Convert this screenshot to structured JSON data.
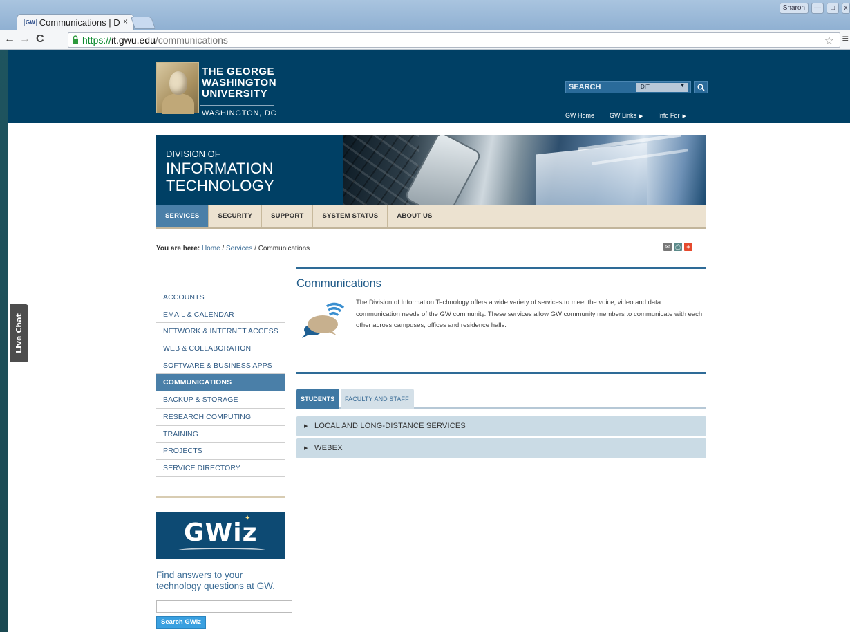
{
  "browser": {
    "tab_title": "Communications | D",
    "tab_favicon": "GW",
    "tab_close": "×",
    "user_label": "Sharon",
    "url_scheme": "https://",
    "url_host": "it.gwu.edu",
    "url_path": "/communications"
  },
  "header": {
    "logo_line1": "THE GEORGE",
    "logo_line2": "WASHINGTON",
    "logo_line3": "UNIVERSITY",
    "logo_city": "WASHINGTON, DC",
    "search_label": "SEARCH",
    "search_scope": "DIT",
    "links": [
      {
        "label": "GW Home"
      },
      {
        "label": "GW Links"
      },
      {
        "label": "Info For"
      }
    ]
  },
  "banner": {
    "line_small": "DIVISION OF",
    "line_big1": "INFORMATION",
    "line_big2": "TECHNOLOGY"
  },
  "main_nav": [
    {
      "label": "SERVICES",
      "active": true
    },
    {
      "label": "SECURITY"
    },
    {
      "label": "SUPPORT"
    },
    {
      "label": "SYSTEM STATUS"
    },
    {
      "label": "ABOUT US"
    }
  ],
  "breadcrumb": {
    "prefix": "You are here:",
    "home": "Home",
    "sep1": " / ",
    "services": "Services",
    "sep2": " / ",
    "current": "Communications"
  },
  "sidebar": [
    {
      "label": "ACCOUNTS"
    },
    {
      "label": "EMAIL & CALENDAR"
    },
    {
      "label": "NETWORK & INTERNET ACCESS"
    },
    {
      "label": "WEB & COLLABORATION"
    },
    {
      "label": "SOFTWARE & BUSINESS APPS"
    },
    {
      "label": "COMMUNICATIONS",
      "active": true
    },
    {
      "label": "BACKUP & STORAGE"
    },
    {
      "label": "RESEARCH COMPUTING"
    },
    {
      "label": "TRAINING"
    },
    {
      "label": "PROJECTS"
    },
    {
      "label": "SERVICE DIRECTORY"
    }
  ],
  "gwiz": {
    "logo_text": "GWiz",
    "tagline": "Find answers to your technology questions at GW.",
    "button_label": "Search GWiz"
  },
  "content": {
    "title": "Communications",
    "intro": "The Division of Information Technology offers a wide variety of services to meet the voice, video and data communication needs of the GW community. These services allow GW community members to communicate with each other across campuses, offices and residence halls.",
    "tabs": [
      {
        "label": "STUDENTS",
        "active": true
      },
      {
        "label": "FACULTY AND STAFF"
      }
    ],
    "accordions": [
      {
        "label": "LOCAL AND LONG-DISTANCE SERVICES"
      },
      {
        "label": "WEBEX"
      }
    ]
  },
  "live_chat_label": "Live Chat",
  "colors": {
    "gw_blue": "#004065",
    "nav_active": "#4a7fa8",
    "nav_bg": "#ece2d0",
    "link": "#2f5a84",
    "accordion_bg": "#cadbe5"
  }
}
